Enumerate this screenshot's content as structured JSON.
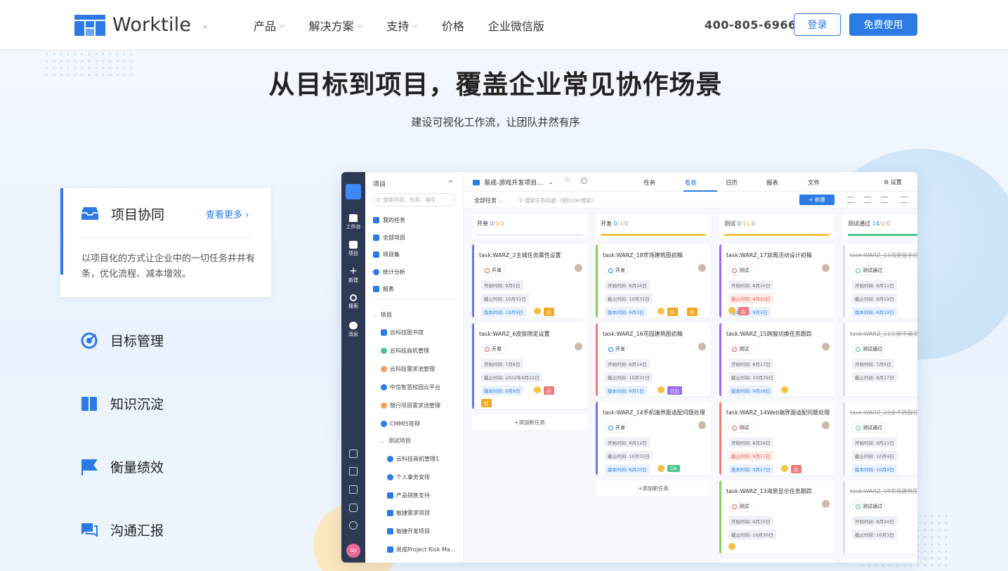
{
  "header": {
    "brand": "Worktile",
    "nav": [
      {
        "label": "产品",
        "has_dropdown": true
      },
      {
        "label": "解决方案",
        "has_dropdown": true
      },
      {
        "label": "支持",
        "has_dropdown": true
      },
      {
        "label": "价格",
        "has_dropdown": false
      },
      {
        "label": "企业微信版",
        "has_dropdown": false
      }
    ],
    "phone": "400-805-6966",
    "login": "登录",
    "free": "免费使用",
    "accent": "#2c7be5"
  },
  "hero": {
    "title": "从目标到项目，覆盖企业常见协作场景",
    "subtitle": "建设可视化工作流，让团队井然有序"
  },
  "features": {
    "active": {
      "title": "项目协同",
      "more": "查看更多",
      "desc": "以项目化的方式让企业中的一切任务井井有条，优化流程、减本增效。"
    },
    "items": [
      "目标管理",
      "知识沉淀",
      "衡量绩效",
      "沟通汇报"
    ]
  },
  "app": {
    "rail": [
      "工作台",
      "项目",
      "新建",
      "搜索",
      "消息"
    ],
    "avatar": "SU",
    "sidebar": {
      "title": "项目",
      "search_placeholder": "搜索项目、任务、编号",
      "items": [
        "我的任务",
        "全部项目",
        "项目集",
        "统计分析",
        "报表"
      ],
      "group": "项目",
      "projects": [
        "云科技图书馆",
        "云科技商机管理",
        "云科技需求池管理",
        "中信智慧校园云平台",
        "银行项目需求池管理",
        "CMMI5答辩",
        "测试项目",
        "云科技商机管理1",
        "个人事务安排",
        "产品销售支持",
        "敏捷需求项目",
        "敏捷开发项目",
        "易成Project Risk Ma..."
      ]
    },
    "project_name": "易成-游戏开发项目...",
    "tabs": [
      "任务",
      "看板",
      "日历",
      "报表",
      "文件"
    ],
    "settings": "设置",
    "filter": "全部任务",
    "search_placeholder": "搜索任务标题（按Enter搜索）",
    "new_btn": "+ 新建",
    "add_task": "添加新任务",
    "columns": [
      {
        "name": "开单",
        "counts": [
          "0",
          "0",
          "2"
        ],
        "bar": "#eceff3",
        "cards": [
          {
            "title": "task:WARZ_2主城任务属性设置",
            "status": "开单",
            "start": "开始时间: 9月5日",
            "end": "截止时间: 10月31日",
            "version": "版本时间: 10月9日",
            "tags": [
              "前"
            ]
          },
          {
            "title": "task:WARZ_6皮肤限定设置",
            "status": "开单",
            "start": "开始时间: 7月8日",
            "end": "截止时间: 2022年9月22日",
            "version": "版本时间: 9月9日",
            "tags": [
              "后",
              "前"
            ]
          }
        ]
      },
      {
        "name": "开发",
        "counts": [
          "0",
          "3",
          "0"
        ],
        "bar": "#f6c243",
        "cards": [
          {
            "title": "task:WARZ_18农场建筑图初稿",
            "status": "开发",
            "start": "开始时间: 8月16日",
            "end": "截止时间: 10月31日",
            "version": "版本时间: 9月3日",
            "tags": [
              "前",
              "前"
            ]
          },
          {
            "title": "task:WARZ_16花园建筑图初稿",
            "status": "开发",
            "start": "开始时间: 8月14日",
            "end": "截止时间: 10月31日",
            "version": "版本时间: 9月1日",
            "tags": [
              "已出"
            ]
          },
          {
            "title": "task:WARZ_14手机端界面适配问题处理",
            "status": "开发",
            "start": "开始时间: 8月12日",
            "end": "截止时间: 10月31日",
            "version": "版本时间: 8月20日",
            "tags": [
              "QA"
            ]
          }
        ]
      },
      {
        "name": "测试",
        "counts": [
          "0",
          "11",
          "0"
        ],
        "bar": "#f6c243",
        "cards": [
          {
            "title": "task:WARZ_17双周活动设计初稿",
            "status": "测试",
            "start": "开始时间: 8月15日",
            "end": "截止时间: 9月30日",
            "version": "版本时间: 9月2日",
            "tags": [
              "后"
            ]
          },
          {
            "title": "task:WARZ_15跨服切换任务跟踪",
            "status": "测试",
            "start": "开始时间: 8月17日",
            "end": "截止时间: 10月29日",
            "version": "版本时间: 9月18日",
            "tags": []
          },
          {
            "title": "task:WARZ_14Web端界面适配问题处理",
            "status": "测试",
            "start": "开始时间: 8月16日",
            "end": "截止时间: 9月17日",
            "version": "版本时间: 9月17日",
            "tags": [
              "后"
            ]
          },
          {
            "title": "task:WARZ_13海景显示任务跟踪",
            "status": "测试",
            "start": "开始时间: 8月15日",
            "end": "截止时间: 10月30日",
            "version": "",
            "tags": []
          }
        ]
      },
      {
        "name": "测试通过",
        "counts": [
          "14",
          "0",
          "0"
        ],
        "bar": "#4cc590",
        "cards": [
          {
            "title": "task:WARZ_13海景显示任务",
            "status": "测试通过",
            "start": "开始时间: 8月11日",
            "end": "截止时间: 8月19日",
            "version": "版本时间: 8月19日",
            "tags": []
          },
          {
            "title": "task:WARZ_11头部中英文",
            "status": "测试通过",
            "start": "开始时间: 7月9日",
            "end": "截止时间: 8月17日",
            "version": "",
            "tags": []
          },
          {
            "title": "task:WARZ_23全不跨服任务",
            "status": "测试通过",
            "start": "开始时间: 8月21日",
            "end": "截止时间: 10月4日",
            "version": "版本时间: 10月4日",
            "tags": []
          },
          {
            "title": "task:WARZ_18农场建筑图初",
            "status": "测试通过",
            "start": "开始时间: 8月20日",
            "end": "截止时间: 10月3日",
            "version": "",
            "tags": []
          }
        ]
      }
    ]
  }
}
